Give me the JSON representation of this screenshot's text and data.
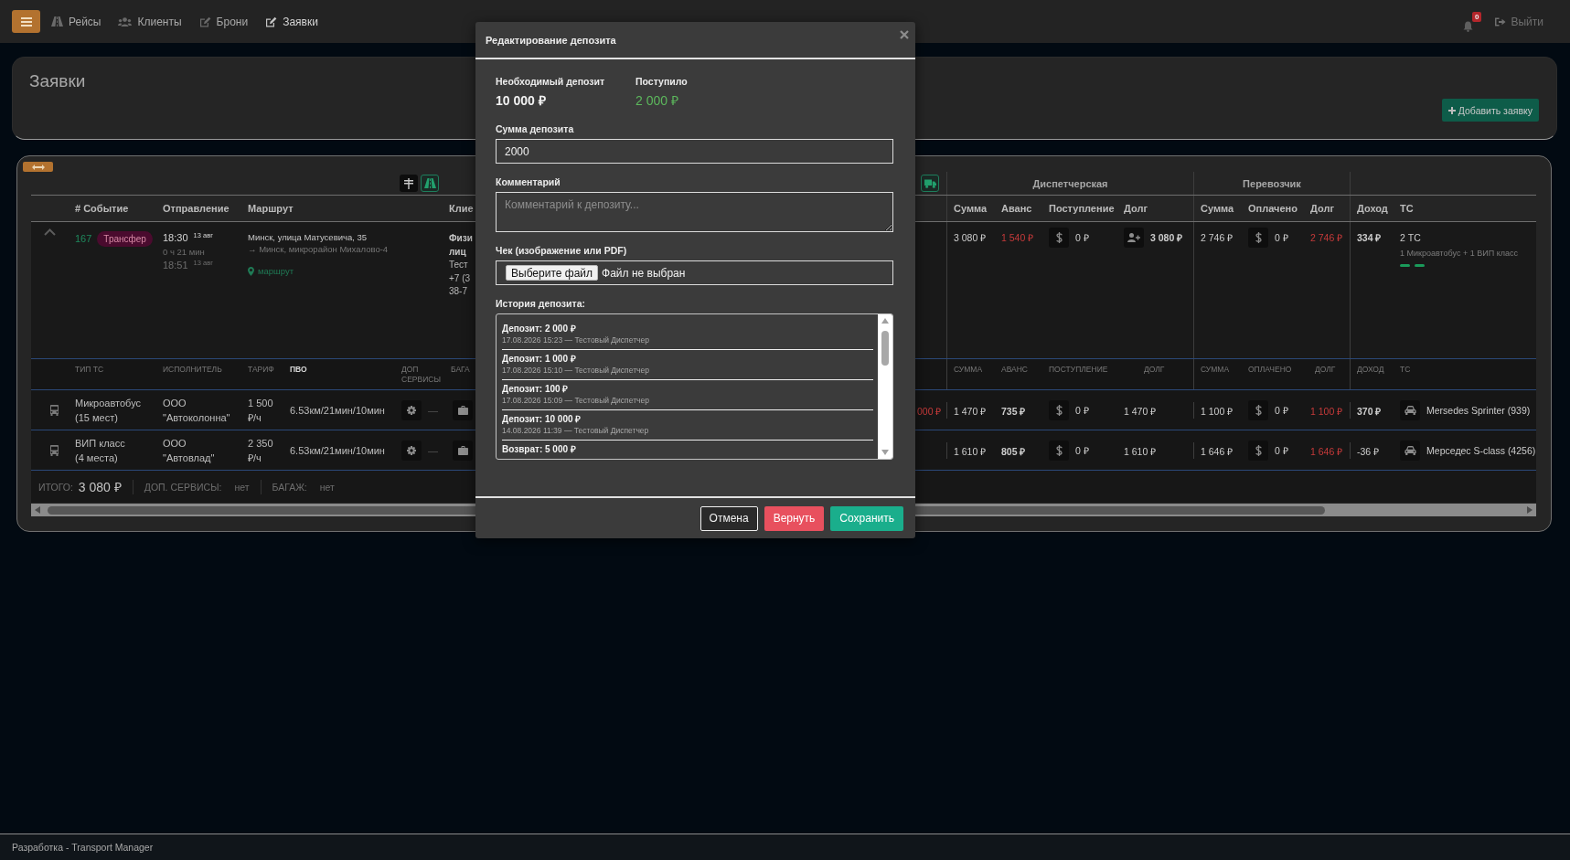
{
  "nav": {
    "items": [
      {
        "label": "Рейсы",
        "selected": false
      },
      {
        "label": "Клиенты",
        "selected": false
      },
      {
        "label": "Брони",
        "selected": false
      },
      {
        "label": "Заявки",
        "selected": true
      }
    ],
    "notification_count": "0",
    "logout": "Выйти"
  },
  "page": {
    "title": "Заявки",
    "add_button": "Добавить заявку"
  },
  "table": {
    "view_toggles": [
      {
        "on": false
      },
      {
        "on": true
      },
      {
        "on": true
      }
    ],
    "groups": [
      "Диспетчерская",
      "Перевозчик"
    ],
    "columns": [
      "# Событие",
      "Отправление",
      "Маршрут",
      "Клие"
    ],
    "dispatch_columns": [
      "Сумма",
      "Аванс",
      "Поступление",
      "Долг"
    ],
    "carrier_columns": [
      "Сумма",
      "Оплачено",
      "Долг"
    ],
    "extra_columns": [
      "Доход",
      "ТС"
    ],
    "order": {
      "expanded": true,
      "number": "167",
      "event": "Трансфер",
      "departure": "18:30 $^{13 авг}$",
      "duration": "0 ч 21 мин",
      "arrival": "18:51 $^{13 авг}$",
      "route_from": "Минск, улица Матусевича, 35",
      "route_to": "→ Минск, микрорайон Михалово-4",
      "route_link": "маршрут",
      "client": [
        {
          "kind": "type",
          "text": "Физи"
        },
        {
          "kind": "type",
          "text": "лиц"
        },
        {
          "kind": "name",
          "text": "Тест"
        },
        {
          "kind": "phone",
          "text": "+7 (3"
        },
        {
          "kind": "phone",
          "text": "38-7"
        }
      ],
      "dispatch": {
        "sum": "3 080 ₽",
        "advance": "1 540 ₽",
        "received": "0 ₽",
        "debt": "3 080 ₽"
      },
      "carrier": {
        "sum": "2 746 ₽",
        "paid": "0 ₽",
        "debt": "2 746 ₽"
      },
      "income": "334 ₽",
      "vehicle_count": "2 ТС",
      "vehicle_summary": "1 Микроавтобус + 1 ВИП класс"
    },
    "vehicle_columns": [
      {
        "label": "ТИП ТС",
        "active": false
      },
      {
        "label": "ИСПОЛНИТЕЛЬ",
        "active": false
      },
      {
        "label": "ТАРИФ",
        "active": false
      },
      {
        "label": "ПВО",
        "active": true
      },
      {
        "label": "ДОП СЕРВИСЫ",
        "active": false
      },
      {
        "label": "БАГА",
        "active": false
      }
    ],
    "vehicle_right_columns": [
      "СУММА",
      "АВАНС",
      "ПОСТУПЛЕНИЕ",
      "ДОЛГ",
      "СУММА",
      "ОПЛАЧЕНО",
      "ДОЛГ",
      "ДОХОД",
      "ТС"
    ],
    "vehicles": [
      {
        "type": "Микроавтобус",
        "seats": "(15 мест)",
        "contractor": "ООО \"Автоколонна\"",
        "tariff": "1 500 ₽/ч",
        "pvo": "6.53км/21мин/10мин",
        "services": "—",
        "deposit": "000 ₽",
        "dispatch": {
          "sum": "1 470 ₽",
          "advance": "735 ₽",
          "received": "0 ₽",
          "debt": "1 470 ₽"
        },
        "carrier": {
          "sum": "1 100 ₽",
          "paid": "0 ₽",
          "debt": "1 100 ₽"
        },
        "income": "370 ₽",
        "loss": false,
        "vehicle": "Mersedes Sprinter (939)"
      },
      {
        "type": "ВИП класс",
        "seats": "(4 места)",
        "contractor": "ООО \"Автовлад\"",
        "tariff": "2 350 ₽/ч",
        "pvo": "6.53км/21мин/10мин",
        "services": "—",
        "dispatch": {
          "sum": "1 610 ₽",
          "advance": "805 ₽",
          "received": "0 ₽",
          "debt": "1 610 ₽"
        },
        "carrier": {
          "sum": "1 646 ₽",
          "paid": "0 ₽",
          "debt": "1 646 ₽"
        },
        "income": "-36 ₽",
        "loss": true,
        "vehicle": "Мерседес S-class (4256)"
      }
    ],
    "totals": [
      {
        "label": "ИТОГО:",
        "value": "3 080 ₽"
      },
      {
        "label": "ДОП. СЕРВИСЫ:",
        "value": "нет"
      },
      {
        "label": "БАГАЖ:",
        "value": "нет"
      }
    ]
  },
  "modal": {
    "title": "Редактирование депозита",
    "summary": [
      {
        "kind": "required",
        "label": "Необходимый депозит",
        "value": "10 000 ₽"
      },
      {
        "kind": "received",
        "label": "Поступило",
        "value": "2 000 ₽"
      }
    ],
    "amount": {
      "label": "Сумма депозита",
      "value": "2000"
    },
    "comment": {
      "label": "Комментарий",
      "placeholder": "Комментарий к депозиту..."
    },
    "receipt": {
      "label": "Чек (изображение или PDF)",
      "button": "Выберите файл",
      "status": "Файл не выбран"
    },
    "history": {
      "label": "История депозита:",
      "items": [
        {
          "title": "Депозит: 2 000 ₽",
          "meta": "17.08.2026 15:23 — Тестовый Диспетчер"
        },
        {
          "title": "Депозит: 1 000 ₽",
          "meta": "17.08.2026 15:10 — Тестовый Диспетчер"
        },
        {
          "title": "Депозит: 100 ₽",
          "meta": "17.08.2026 15:09 — Тестовый Диспетчер"
        },
        {
          "title": "Депозит: 10 000 ₽",
          "meta": "14.08.2026 11:39 — Тестовый Диспетчер"
        },
        {
          "title": "Возврат: 5 000 ₽"
        }
      ]
    },
    "buttons": [
      {
        "kind": "cancel",
        "label": "Отмена"
      },
      {
        "kind": "refund",
        "label": "Вернуть"
      },
      {
        "kind": "save",
        "label": "Сохранить"
      }
    ]
  },
  "footer": "Разработка - Transport Manager"
}
